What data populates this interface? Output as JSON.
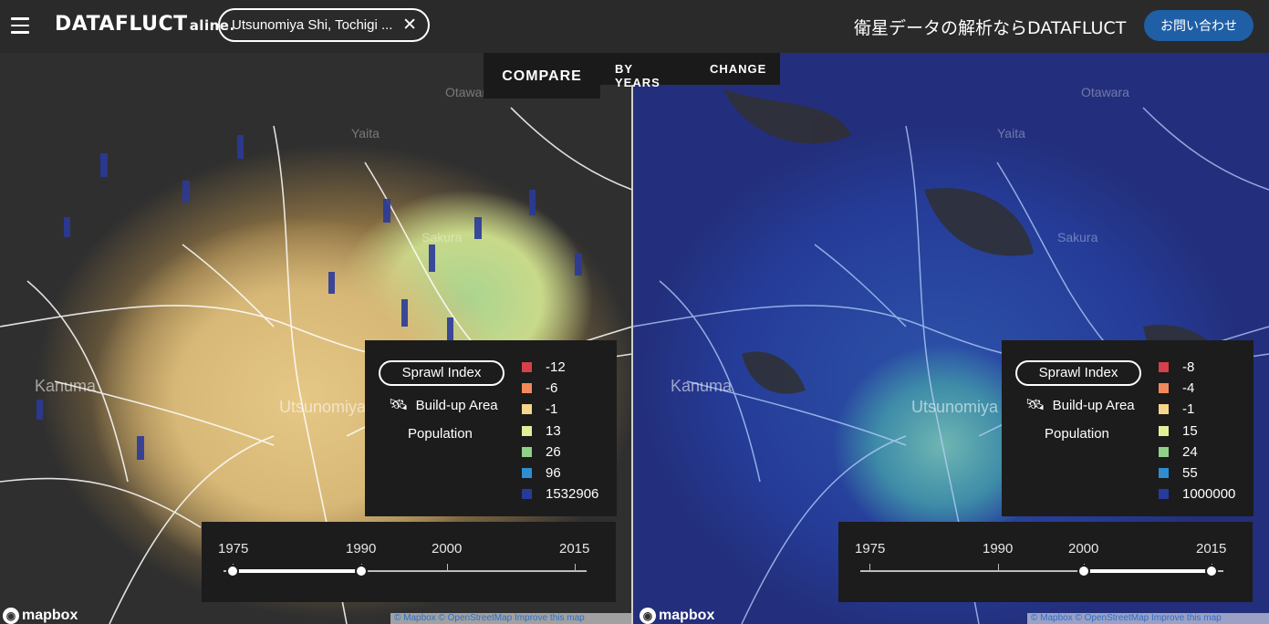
{
  "header": {
    "brand": "DATAFLUCT",
    "brand_sub": "aline.",
    "search_value": "Utsunomiya Shi, Tochigi ...",
    "close_symbol": "✕",
    "tagline": "衛星データの解析ならDATAFLUCT",
    "contact_label": "お問い合わせ"
  },
  "tabs": {
    "compare": "COMPARE",
    "by_years": "BY YEARS",
    "change": "CHANGE",
    "active": "compare"
  },
  "map_labels": {
    "kanuma": "Kanuma",
    "utsunomiya": "Utsunomiya",
    "sakura": "Sakura",
    "yaita": "Yaita",
    "otawara": "Otawara"
  },
  "left_panel": {
    "legend": {
      "sprawl_label": "Sprawl Index",
      "build_label": "Build-up Area",
      "population_label": "Population",
      "items": [
        {
          "value": "-12",
          "color": "#d6404a"
        },
        {
          "value": "-6",
          "color": "#f08a5a"
        },
        {
          "value": "-1",
          "color": "#f5d68a"
        },
        {
          "value": "13",
          "color": "#e4ee9a"
        },
        {
          "value": "26",
          "color": "#8fd08a"
        },
        {
          "value": "96",
          "color": "#2e8ed0"
        },
        {
          "value": "1532906",
          "color": "#283a9a"
        }
      ]
    },
    "slider": {
      "years": [
        "1975",
        "1990",
        "2000",
        "2015"
      ],
      "selected_range": [
        "1975",
        "1990"
      ]
    }
  },
  "right_panel": {
    "legend": {
      "sprawl_label": "Sprawl Index",
      "build_label": "Build-up Area",
      "population_label": "Population",
      "items": [
        {
          "value": "-8",
          "color": "#d6404a"
        },
        {
          "value": "-4",
          "color": "#f08a5a"
        },
        {
          "value": "-1",
          "color": "#f5d68a"
        },
        {
          "value": "15",
          "color": "#e4ee9a"
        },
        {
          "value": "24",
          "color": "#8fd08a"
        },
        {
          "value": "55",
          "color": "#2e8ed0"
        },
        {
          "value": "1000000",
          "color": "#283a9a"
        }
      ]
    },
    "slider": {
      "years": [
        "1975",
        "1990",
        "2000",
        "2015"
      ],
      "selected_range": [
        "2000",
        "2015"
      ]
    }
  },
  "footer": {
    "mapbox": "mapbox",
    "attribution": "© Mapbox © OpenStreetMap Improve this map"
  },
  "icons": {
    "menu": "menu-icon",
    "close": "close-icon",
    "satellite": "satellite-icon",
    "mapbox": "mapbox-logo-icon"
  }
}
